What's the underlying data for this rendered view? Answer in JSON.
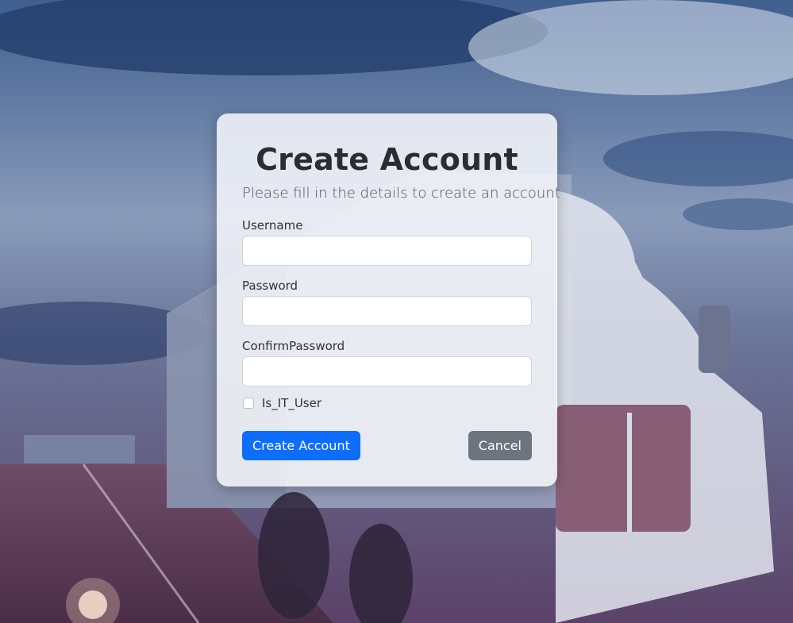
{
  "form": {
    "title": "Create Account",
    "subtitle": "Please fill in the details to create an account",
    "fields": {
      "username": {
        "label": "Username",
        "value": "",
        "placeholder": ""
      },
      "password": {
        "label": "Password",
        "value": "",
        "placeholder": ""
      },
      "confirm_password": {
        "label": "ConfirmPassword",
        "value": "",
        "placeholder": ""
      }
    },
    "checkbox": {
      "label": "Is_IT_User",
      "checked": false
    },
    "buttons": {
      "create_label": "Create Account",
      "cancel_label": "Cancel"
    }
  },
  "colors": {
    "primary": "#0d6efd",
    "secondary": "#6c757d",
    "card_background": "#f6f7fa",
    "title_text": "#2b2d30"
  }
}
